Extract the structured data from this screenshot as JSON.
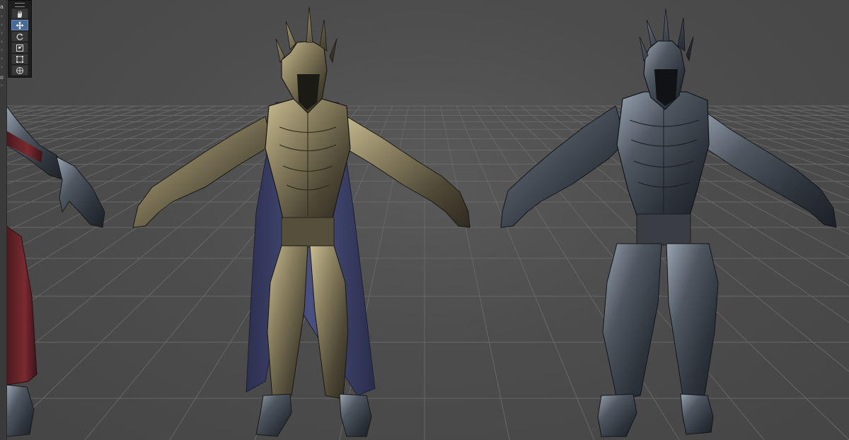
{
  "app": {
    "accent_color": "#4a6a96",
    "background_color": "#4a4a4a",
    "grid_color": "#6a6a6a"
  },
  "left_strip": {
    "labels": [
      {
        "text": "a"
      },
      {
        "text": "o"
      }
    ]
  },
  "toolbar": {
    "tools": [
      {
        "icon": "hand-icon",
        "active": false
      },
      {
        "icon": "move-icon",
        "active": true
      },
      {
        "icon": "rotate-icon",
        "active": false
      },
      {
        "icon": "scale-icon",
        "active": false
      },
      {
        "icon": "rect-transform-icon",
        "active": false
      },
      {
        "icon": "transform-all-icon",
        "active": false
      }
    ]
  },
  "scene": {
    "models": [
      {
        "name": "partial-model-left",
        "armor_color": "#5a5a5e",
        "cloth_color": "#7a2a30"
      },
      {
        "name": "armored-knight-gold",
        "armor_color": "#8a8060",
        "cloth_color": "#3c4068"
      },
      {
        "name": "armored-knight-steel",
        "armor_color": "#4a5058",
        "cloth_color": ""
      }
    ]
  }
}
